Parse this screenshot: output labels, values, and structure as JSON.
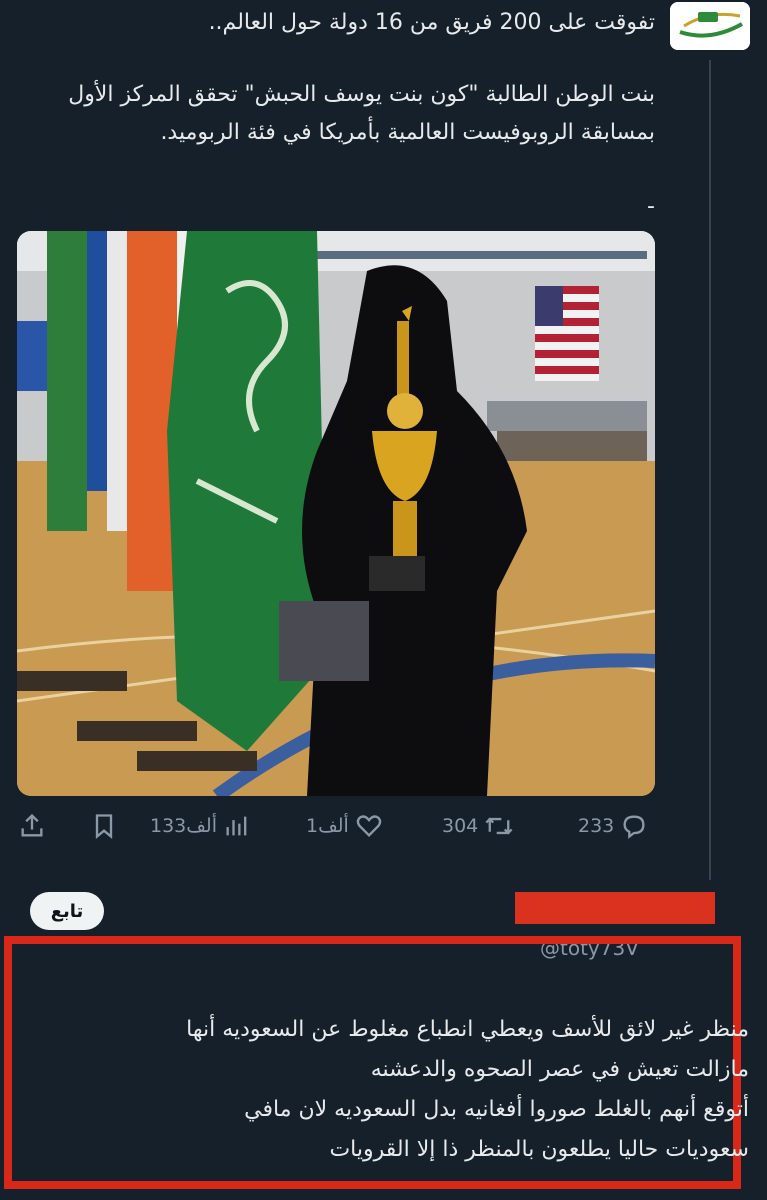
{
  "tweet": {
    "headline": "تفوقت على 200 فريق من 16 دولة حول العالم..",
    "body": "بنت الوطن الطالبة \"كون بنت يوسف الحبش\" تحقق المركز الأول بمسابقة الروبوفيست العالمية بأمريكا في فئة الربوميد.",
    "separator": "-"
  },
  "actions": {
    "replies": "233",
    "retweets": "304",
    "likes": "1ألف",
    "views": "133ألف"
  },
  "follow_button": "تابع",
  "reply": {
    "handle": "@toty73V",
    "lines": [
      "منظر غير لائق للأسف ويعطي انطباع مغلوط عن السعوديه أنها",
      "مازالت تعيش في عصر الصحوه والدعشنه",
      "أتوقع أنهم بالغلط صوروا أفغانيه بدل السعوديه لان مافي",
      "سعوديات حاليا يطلعون بالمنظر ذا إلا القرويات"
    ]
  },
  "colors": {
    "background": "#15202b",
    "text": "#e7e9ea",
    "muted": "#8b98a5",
    "highlight_frame": "#d7281a"
  }
}
